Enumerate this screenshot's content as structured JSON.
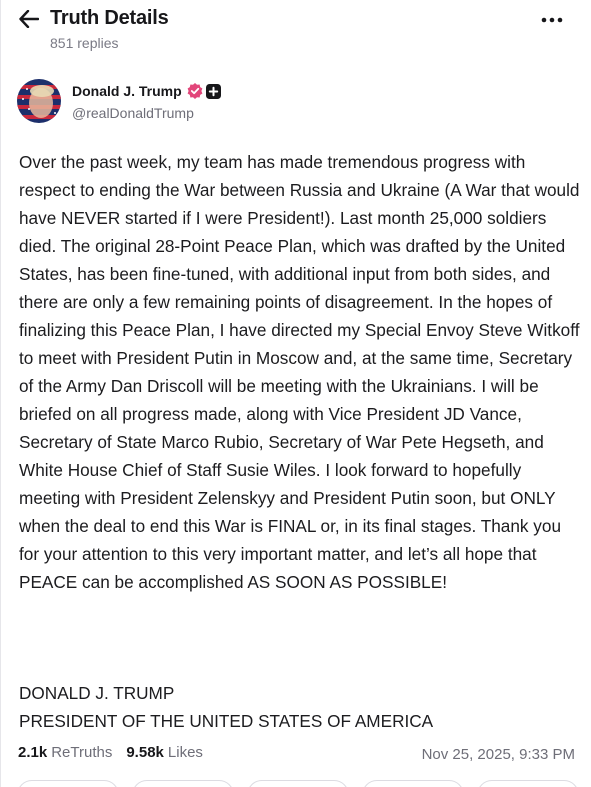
{
  "header": {
    "title": "Truth Details",
    "replies": "851 replies"
  },
  "author": {
    "name": "Donald J. Trump",
    "handle": "@realDonaldTrump"
  },
  "post": {
    "body": "Over the past week, my team has made tremendous progress with respect to ending the War between Russia and Ukraine (A War that would have NEVER started if I were President!). Last month 25,000 soldiers died. The original 28-Point Peace Plan, which was drafted by the United States, has been fine-tuned, with additional input from both sides, and there are only a few remaining points of disagreement. In the hopes of finalizing this Peace Plan, I have directed my Special Envoy Steve Witkoff to meet with President Putin in Moscow and, at the same time, Secretary of the Army Dan Driscoll will be meeting with the Ukrainians. I will be briefed on all progress made, along with Vice President JD Vance, Secretary of State Marco Rubio, Secretary of War Pete Hegseth, and White House Chief of Staff Susie Wiles. I look forward to hopefully meeting with President Zelenskyy and President Putin soon, but ONLY when the deal to end this War is FINAL or, in its final stages. Thank you for your attention to this very important matter, and let’s all hope that PEACE can be accomplished AS SOON AS POSSIBLE!",
    "signature_line1": "DONALD J. TRUMP",
    "signature_line2": "PRESIDENT OF THE UNITED STATES OF AMERICA"
  },
  "stats": {
    "retruths_count": "2.1k",
    "retruths_label": "ReTruths",
    "likes_count": "9.58k",
    "likes_label": "Likes",
    "timestamp": "Nov 25, 2025, 9:33 PM"
  },
  "icons": {
    "back": "arrow-left-icon",
    "more": "more-horizontal-icon",
    "verified": "verified-badge-icon",
    "plus": "plus-square-icon"
  },
  "colors": {
    "verified_badge": "#e2467a",
    "text": "#17171a",
    "muted": "#6e6e78"
  }
}
